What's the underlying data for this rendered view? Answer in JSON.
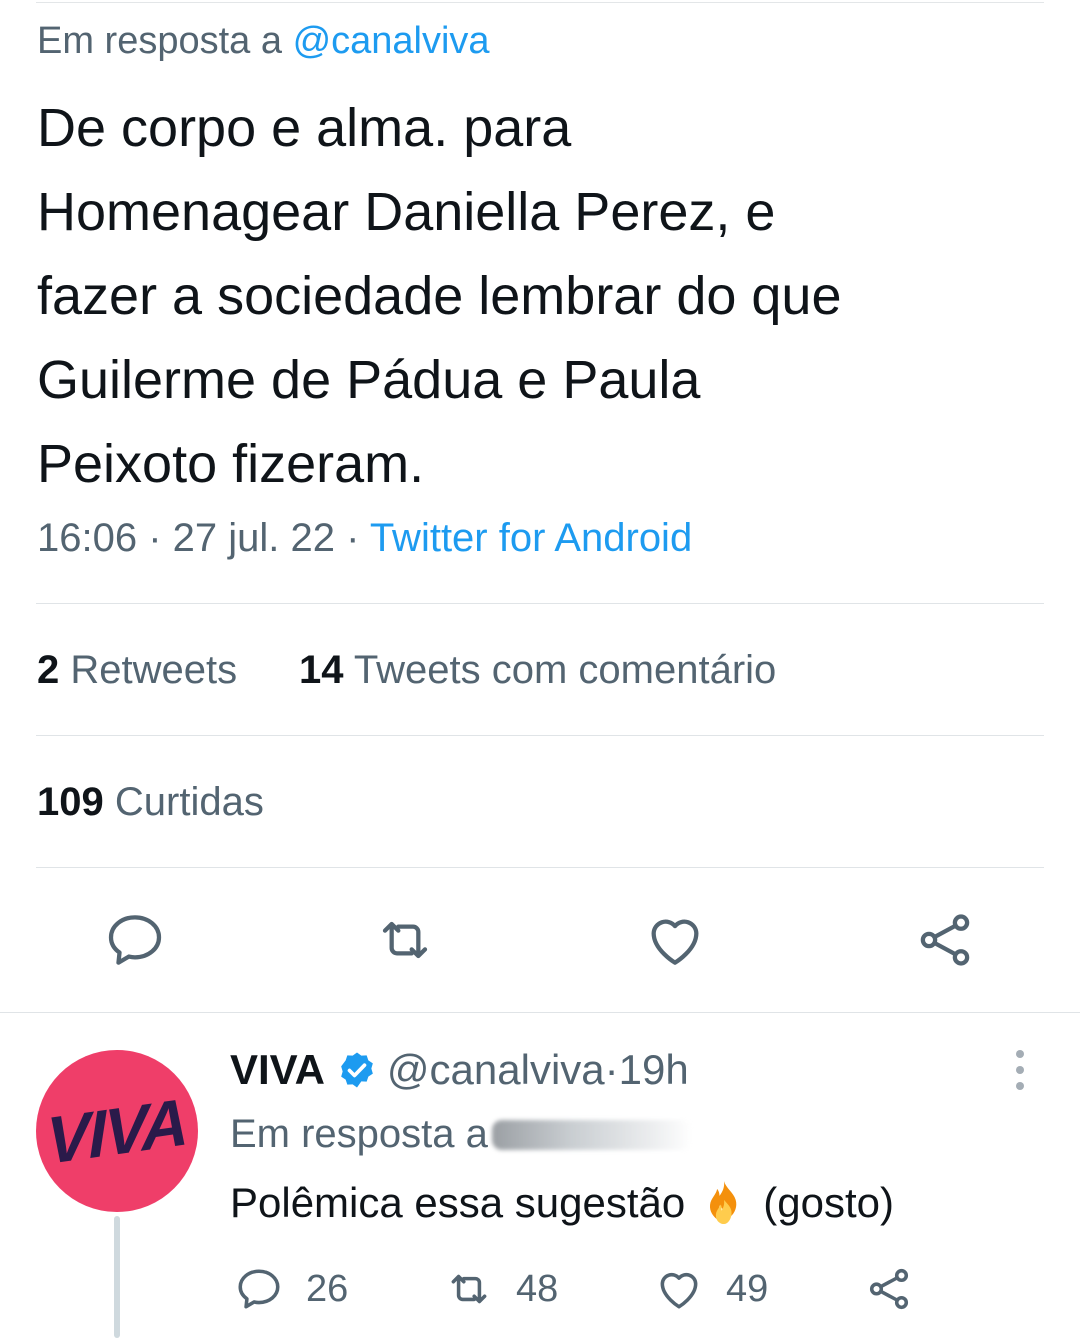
{
  "tweet": {
    "reply_prefix": "Em resposta a ",
    "reply_handle": "@canalviva",
    "text": "De corpo e alma. para\nHomenagear Daniella Perez, e\nfazer a sociedade lembrar do que\nGuilerme de Pádua e Paula\nPeixoto fizeram.",
    "time": "16:06",
    "date": "27 jul. 22",
    "separator": " · ",
    "source": "Twitter for Android",
    "retweets_count": "2",
    "retweets_label": "Retweets",
    "quotes_count": "14",
    "quotes_label": "Tweets com comentário",
    "likes_count": "109",
    "likes_label": "Curtidas",
    "actions": [
      "reply-icon",
      "retweet-icon",
      "like-icon",
      "share-icon"
    ]
  },
  "reply": {
    "avatar_text": "VIVA",
    "name": "VIVA",
    "handle": "@canalviva",
    "dot": " · ",
    "time": "19h",
    "reply_prefix": "Em resposta a",
    "text_before": "Polêmica essa sugestão",
    "emoji": "fire",
    "text_after": "(gosto)",
    "reply_count": "26",
    "retweet_count": "48",
    "like_count": "49"
  },
  "colors": {
    "accent": "#1d9bf0",
    "secondary_text": "#536471",
    "avatar_bg": "#ef3e69"
  }
}
